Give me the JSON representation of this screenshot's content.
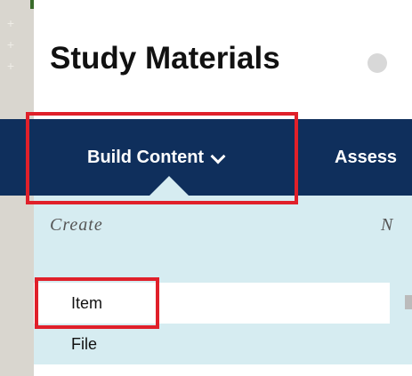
{
  "page": {
    "title": "Study Materials"
  },
  "action_bar": {
    "build_content_label": "Build Content",
    "assess_label": "Assess"
  },
  "dropdown": {
    "create_heading": "Create",
    "new_heading": "N",
    "items": [
      {
        "label": "Item"
      },
      {
        "label": "File"
      }
    ]
  },
  "colors": {
    "nav_bar": "#0f2f5c",
    "panel": "#d6ecf1",
    "highlight": "#e0202a"
  }
}
